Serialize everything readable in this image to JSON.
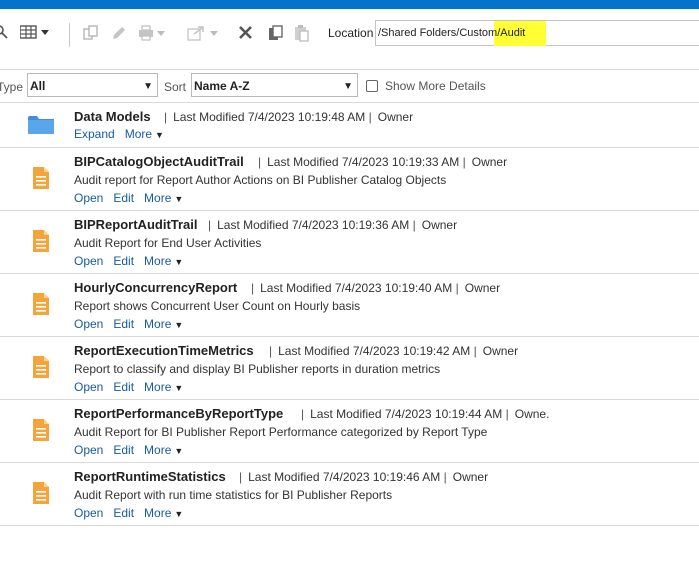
{
  "toolbar": {
    "location_label": "Location",
    "location_path": "/Shared Folders/Custom/",
    "location_current": "Audit"
  },
  "filters": {
    "type_label": "Type",
    "type_value": "All",
    "sort_label": "Sort",
    "sort_value": "Name A-Z",
    "show_more_label": "Show More Details"
  },
  "folder": {
    "title": "Data Models",
    "modified_label": "Last Modified",
    "modified": "7/4/2023 10:19:48 AM",
    "owner_label": "Owner",
    "actions": [
      "Expand",
      "More"
    ]
  },
  "reports": [
    {
      "title": "BIPCatalogObjectAuditTrail",
      "modified_label": "Last Modified",
      "modified": "7/4/2023 10:19:33 AM",
      "owner_label": "Owner",
      "description": "Audit report for Report Author Actions on BI Publisher Catalog Objects",
      "open": "Open",
      "edit": "Edit",
      "more": "More"
    },
    {
      "title": "BIPReportAuditTrail",
      "modified_label": "Last Modified",
      "modified": "7/4/2023 10:19:36 AM",
      "owner_label": "Owner",
      "description": "Audit Report for End User Activities",
      "open": "Open",
      "edit": "Edit",
      "more": "More"
    },
    {
      "title": "HourlyConcurrencyReport",
      "modified_label": "Last Modified",
      "modified": "7/4/2023 10:19:40 AM",
      "owner_label": "Owner",
      "description": "Report shows Concurrent User Count on Hourly basis",
      "open": "Open",
      "edit": "Edit",
      "more": "More"
    },
    {
      "title": "ReportExecutionTimeMetrics",
      "modified_label": "Last Modified",
      "modified": "7/4/2023 10:19:42 AM",
      "owner_label": "Owner",
      "description": "Report to classify and display BI Publisher reports in duration metrics",
      "open": "Open",
      "edit": "Edit",
      "more": "More"
    },
    {
      "title": "ReportPerformanceByReportType",
      "modified_label": "Last Modified",
      "modified": "7/4/2023 10:19:44 AM",
      "owner_label": "Owne.",
      "description": "Audit Report for BI Publisher Report Performance categorized by Report Type",
      "open": "Open",
      "edit": "Edit",
      "more": "More"
    },
    {
      "title": "ReportRuntimeStatistics",
      "modified_label": "Last Modified",
      "modified": "7/4/2023 10:19:46 AM",
      "owner_label": "Owner",
      "description": "Audit Report with run time statistics for BI Publisher Reports",
      "open": "Open",
      "edit": "Edit",
      "more": "More"
    }
  ]
}
